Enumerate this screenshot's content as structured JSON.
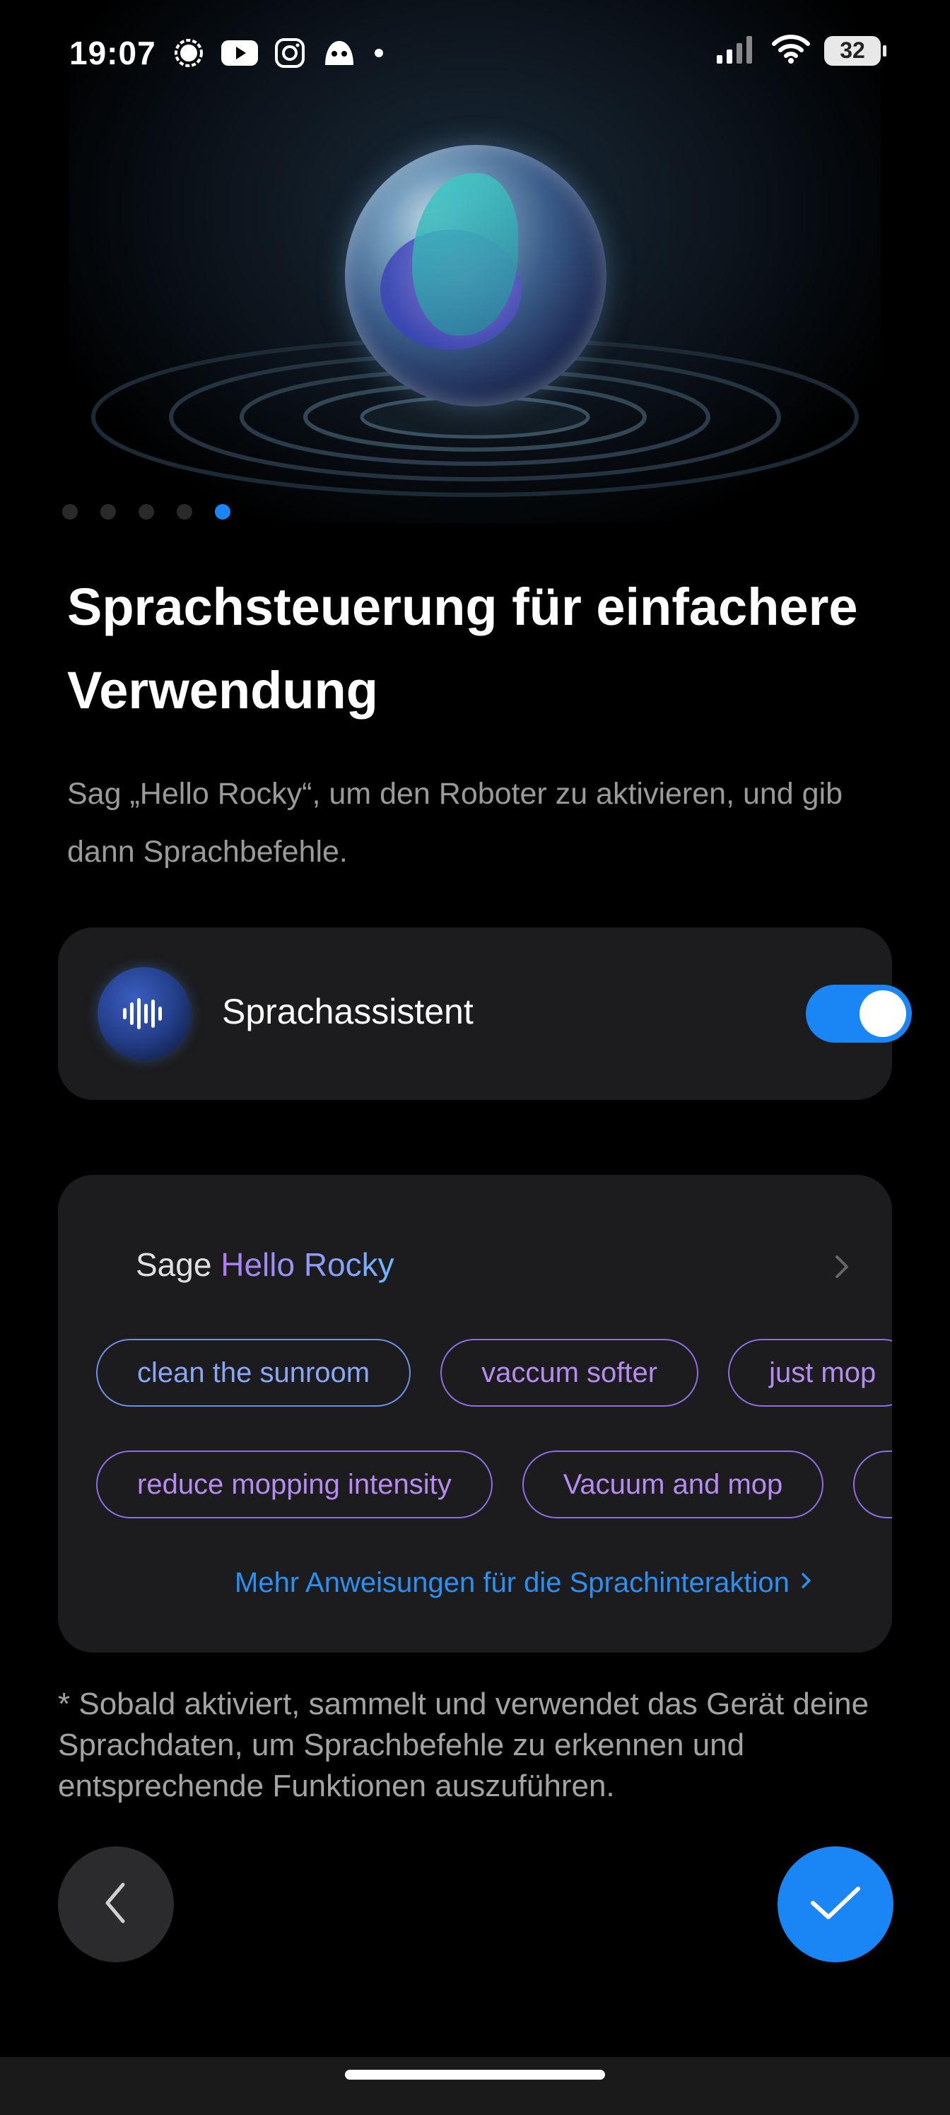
{
  "status_bar": {
    "time": "19:07",
    "battery_level": "32",
    "icons": [
      "signal-messenger-icon",
      "youtube-icon",
      "instagram-icon",
      "app-notification-icon",
      "more-dot-icon"
    ],
    "right_icons": [
      "cellular-signal-icon",
      "wifi-icon",
      "battery-icon"
    ]
  },
  "carousel": {
    "page_count": 5,
    "active_index": 4
  },
  "onboarding": {
    "title": "Sprachsteuerung für einfachere Verwendung",
    "subtitle": "Sag „Hello Rocky“, um den Roboter zu aktivieren, und gib dann Sprachbefehle."
  },
  "assistant_card": {
    "label": "Sprachassistent",
    "toggle_on": true
  },
  "commands_card": {
    "say_prefix": "Sage ",
    "wake_word": "Hello Rocky",
    "chips_row1": [
      "clean the sunroom",
      "vaccum softer",
      "just mop"
    ],
    "chips_row2": [
      "reduce mopping intensity",
      "Vacuum and mop",
      ""
    ],
    "more_link": "Mehr Anweisungen für die Sprachinteraktion"
  },
  "note": "* Sobald aktiviert, sammelt und verwendet das Gerät deine Sprachdaten, um Sprachbefehle zu erkennen und entsprechende Funktionen auszuführen.",
  "colors": {
    "accent": "#1a86f5",
    "card": "#1c1c1e",
    "chip_purple": "#b68cf0",
    "chip_blue": "#8aa7f5",
    "link": "#2d8ff0"
  }
}
